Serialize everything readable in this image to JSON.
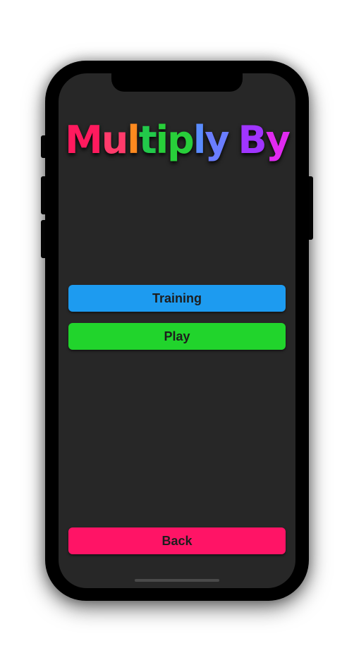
{
  "title": {
    "letters": [
      {
        "char": "M",
        "color": "#ff1a5e"
      },
      {
        "char": "u",
        "color": "#ff3b6b"
      },
      {
        "char": "l",
        "color": "#ff8a1f"
      },
      {
        "char": "t",
        "color": "#22c94a"
      },
      {
        "char": "i",
        "color": "#28cf3a"
      },
      {
        "char": "p",
        "color": "#28cf3a"
      },
      {
        "char": "l",
        "color": "#5a8cff"
      },
      {
        "char": "y",
        "color": "#6a7dff"
      },
      {
        "char": " ",
        "color": "#000000"
      },
      {
        "char": "B",
        "color": "#a035ff"
      },
      {
        "char": "y",
        "color": "#e02af0"
      }
    ]
  },
  "buttons": {
    "training": {
      "label": "Training",
      "color": "#1d9bf0"
    },
    "play": {
      "label": "Play",
      "color": "#21d42c"
    },
    "back": {
      "label": "Back",
      "color": "#ff1466"
    }
  },
  "colors": {
    "screen_background": "#272727",
    "device_frame": "#000000",
    "button_text": "#1d1d1d"
  }
}
